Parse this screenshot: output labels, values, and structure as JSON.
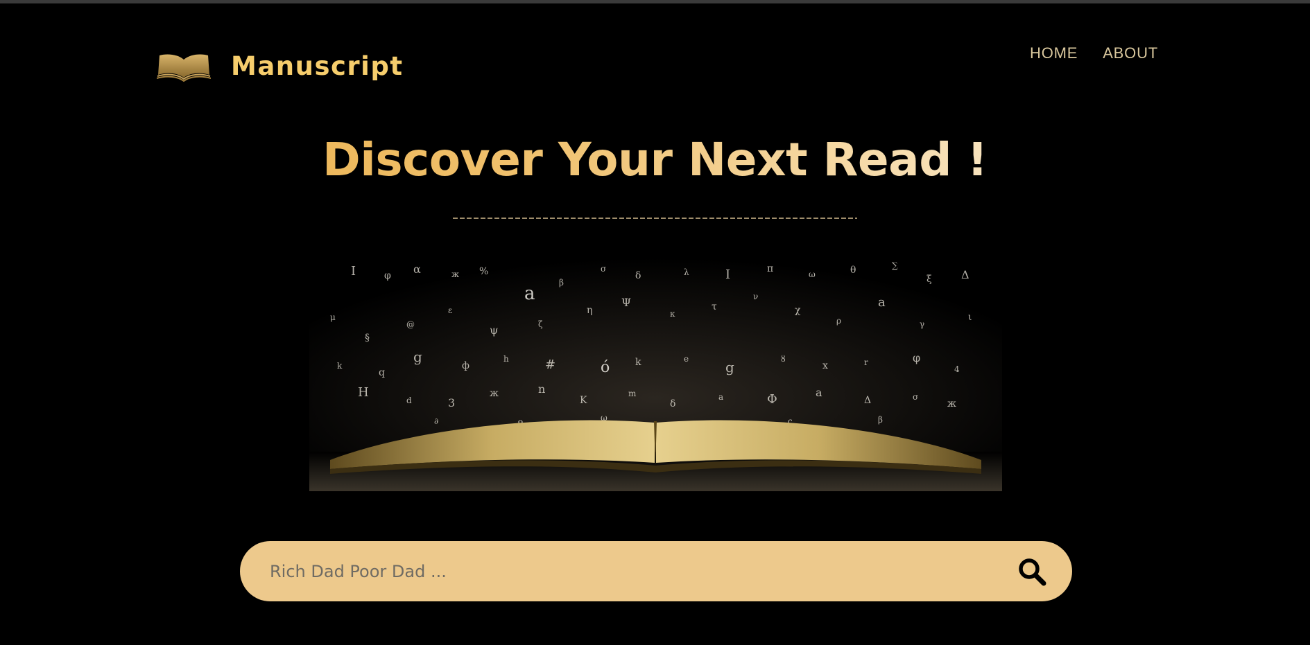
{
  "header": {
    "brand_name": "Manuscript",
    "logo_icon": "open-book-icon",
    "nav": [
      {
        "label": "HOME"
      },
      {
        "label": "ABOUT"
      }
    ]
  },
  "hero": {
    "headline": "Discover Your Next Read !",
    "image_icon": "open-book-with-flying-letters-image"
  },
  "search": {
    "placeholder": "Rich Dad Poor Dad ...",
    "value": "",
    "button_icon": "search-icon"
  },
  "colors": {
    "background": "#000000",
    "brand_gold": "#f6cd6c",
    "nav_text": "#d9c79d",
    "search_bar": "#edc98c",
    "headline_gradient_start": "#e9ab42",
    "headline_gradient_end": "#fbe9c8"
  }
}
